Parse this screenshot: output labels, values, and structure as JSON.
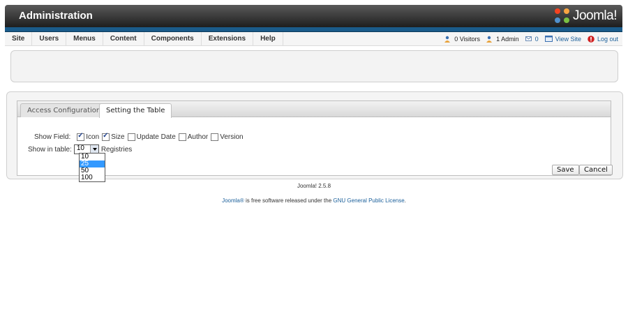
{
  "header": {
    "title": "Administration",
    "logo_text": "Joomla!"
  },
  "menu": [
    "Site",
    "Users",
    "Menus",
    "Content",
    "Components",
    "Extensions",
    "Help"
  ],
  "status": {
    "visitors": "0 Visitors",
    "admins": "1 Admin",
    "messages": "0",
    "view_site": "View Site",
    "logout": "Log out"
  },
  "tabs": [
    {
      "label": "Access Configuration",
      "active": false
    },
    {
      "label": "Setting the Table",
      "active": true
    }
  ],
  "form": {
    "show_field_label": "Show Field:",
    "fields": [
      {
        "label": "Icon",
        "checked": true
      },
      {
        "label": "Size",
        "checked": true
      },
      {
        "label": "Update Date",
        "checked": false
      },
      {
        "label": "Author",
        "checked": false
      },
      {
        "label": "Version",
        "checked": false
      }
    ],
    "show_in_table_label": "Show in table:",
    "selected_value": "10",
    "registries_label": "Registries",
    "options": [
      "10",
      "25",
      "50",
      "100"
    ],
    "highlighted_option": "25"
  },
  "buttons": {
    "save": "Save",
    "cancel": "Cancel"
  },
  "footer": {
    "version": "Joomla! 2.5.8",
    "brand_link": "Joomla®",
    "license_text": " is free software released under the ",
    "license_link": "GNU General Public License",
    "period": "."
  },
  "colors": {
    "header_dark": "#1e1e1e",
    "accent_blue": "#1a5b8a",
    "link": "#1a5f9a",
    "selection": "#3399ff"
  },
  "icons": [
    "joomla-logo-icon",
    "visitors-icon",
    "admin-icon",
    "messages-icon",
    "view-site-icon",
    "logout-icon",
    "select-arrow-icon"
  ]
}
